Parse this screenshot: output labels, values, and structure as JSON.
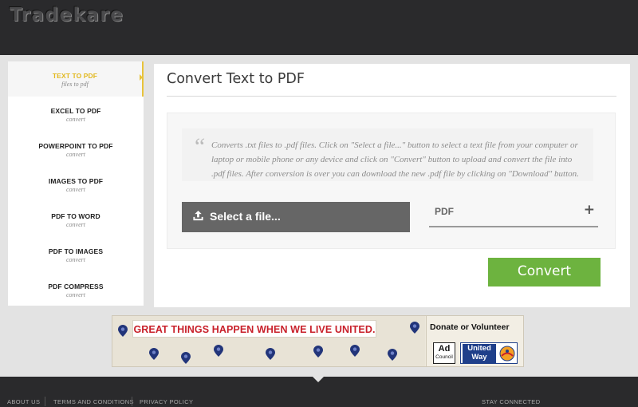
{
  "brand": {
    "logo_text": "Tradekare"
  },
  "sidebar": {
    "items": [
      {
        "title": "TEXT TO PDF",
        "subtitle": "files to pdf"
      },
      {
        "title": "EXCEL TO PDF",
        "subtitle": "convert"
      },
      {
        "title": "POWERPOINT TO PDF",
        "subtitle": "convert"
      },
      {
        "title": "IMAGES TO PDF",
        "subtitle": "convert"
      },
      {
        "title": "PDF TO WORD",
        "subtitle": "convert"
      },
      {
        "title": "PDF TO IMAGES",
        "subtitle": "convert"
      },
      {
        "title": "PDF COMPRESS",
        "subtitle": "convert"
      }
    ],
    "active_accent": "#e8c33a"
  },
  "main": {
    "title": "Convert Text to PDF",
    "description": "Converts .txt files to .pdf files. Click on \"Select a file...\" button to select a text file from your computer or laptop or mobile phone or any device and click on \"Convert\" button to upload and convert the file into .pdf files. After conversion is over you can download the new .pdf file by clicking on \"Download\" button.",
    "select_button_label": "Select a file...",
    "select_button_icon": "upload-icon",
    "format_value": "PDF",
    "format_icon": "plus-icon",
    "convert_label": "Convert",
    "convert_color": "#6db33f"
  },
  "ad": {
    "headline": "GREAT THINGS HAPPEN WHEN WE LIVE UNITED.",
    "cta": "Donate or Volunteer",
    "council_line1": "Ad",
    "council_line2": "Council",
    "uw_line1": "United",
    "uw_line2": "Way",
    "headline_color": "#c8202a"
  },
  "footer": {
    "links": [
      "ABOUT US",
      "TERMS AND CONDITIONS",
      "PRIVACY POLICY"
    ],
    "stay_connected": "STAY CONNECTED"
  }
}
